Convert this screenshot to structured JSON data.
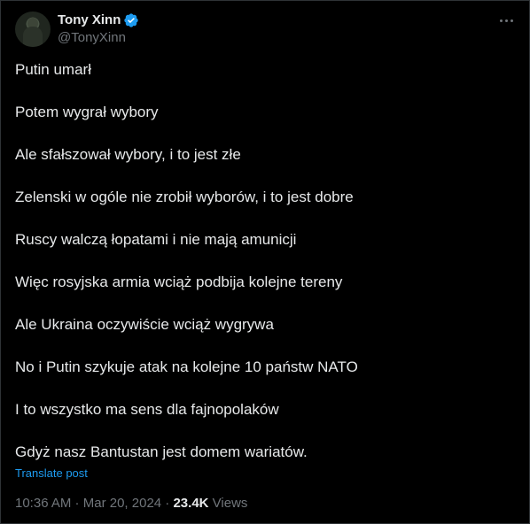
{
  "author": {
    "display_name": "Tony Xinn",
    "handle": "@TonyXinn",
    "verified": true
  },
  "menu_icon": "more-horizontal-icon",
  "post": {
    "lines": [
      "Putin umarł",
      "Potem wygrał wybory",
      "Ale sfałszował wybory, i to jest złe",
      "Zelenski w ogóle nie zrobił wyborów, i to jest dobre",
      "Ruscy walczą łopatami i nie mają amunicji",
      "Więc rosyjska armia wciąż podbija kolejne tereny",
      "Ale Ukraina oczywiście wciąż wygrywa",
      "No i Putin szykuje atak na kolejne 10 państw NATO",
      "I to wszystko ma sens dla fajnopolaków",
      "Gdyż nasz Bantustan jest domem wariatów."
    ],
    "translate_label": "Translate post"
  },
  "meta": {
    "time": "10:36 AM",
    "separator": " · ",
    "date": "Mar 20, 2024",
    "separator2": " · ",
    "views_count": "23.4K",
    "views_label": " Views"
  },
  "colors": {
    "background": "#000000",
    "text": "#e7e9ea",
    "secondary": "#71767b",
    "link": "#1d9bf0",
    "verified": "#1d9bf0"
  }
}
